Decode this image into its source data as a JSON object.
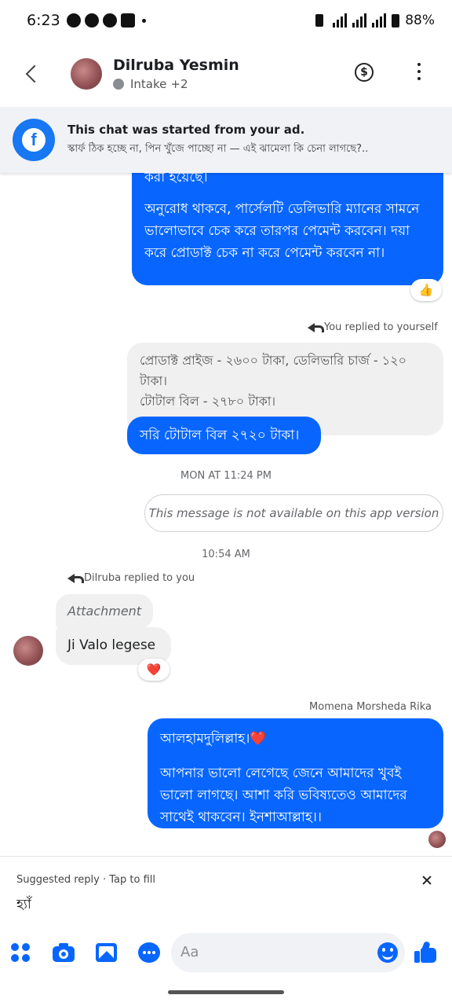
{
  "status_bar": {
    "time": "6:23",
    "battery": "88%"
  },
  "header": {
    "contact_name": "Dilruba Yesmin",
    "label_text": "Intake",
    "extra_labels": "+2",
    "dollar_symbol": "$"
  },
  "ad_banner": {
    "title": "This chat was started from your ad.",
    "subtitle": "স্কার্ফ ঠিক হচ্ছে না, পিন খুঁজে পাচ্ছো না — এই ঝামেলা কি চেনা লাগছে?.."
  },
  "messages": {
    "msg1": {
      "clipped_line": "করা হয়েছে।",
      "text": "অনুরোধ থাকবে, পার্সেলটি ডেলিভারি ম্যানের সামনে ভালোভাবে চেক করে তারপর পেমেন্ট করবেন। দয়া করে প্রোডাক্ট চেক না করে পেমেন্ট করবেন না।",
      "reaction": "👍"
    },
    "reply_note_self": "You replied to yourself",
    "quoted": {
      "line1": "প্রোডাক্ট প্রাইজ - ২৬০০ টাকা, ডেলিভারি চার্জ - ১২০ টাকা।",
      "line2": "টোটাল বিল - ২৭৮০ টাকা।"
    },
    "msg2": "সরি টোটাল বিল ২৭২০ টাকা।",
    "time_1": "MON AT 11:24 PM",
    "unavailable": "This message is not available on this app version",
    "time_2": "10:54 AM",
    "reply_note_other": "Dilruba replied to you",
    "attachment_label": "Attachment",
    "msg3": "Ji Valo legese",
    "msg3_reaction": "❤️",
    "sender_name": "Momena Morsheda Rika",
    "msg4": {
      "line1": "আলহামদুলিল্লাহ।",
      "heart": "❤️",
      "body": "আপনার ভালো লেগেছে জেনে আমাদের খুবই ভালো লাগছে।  আশা করি ভবিষ্যতেও আমাদের সাথেই থাকবেন। ইনশাআল্লাহ।।"
    }
  },
  "suggested_reply": {
    "label": "Suggested reply · Tap to fill",
    "value": "হ্যাঁ"
  },
  "composer": {
    "placeholder": "Aa"
  },
  "icons": {
    "accent": "#0866ff",
    "outgoing_bubble": "#0866ff",
    "incoming_bubble": "#f0f0f0"
  }
}
